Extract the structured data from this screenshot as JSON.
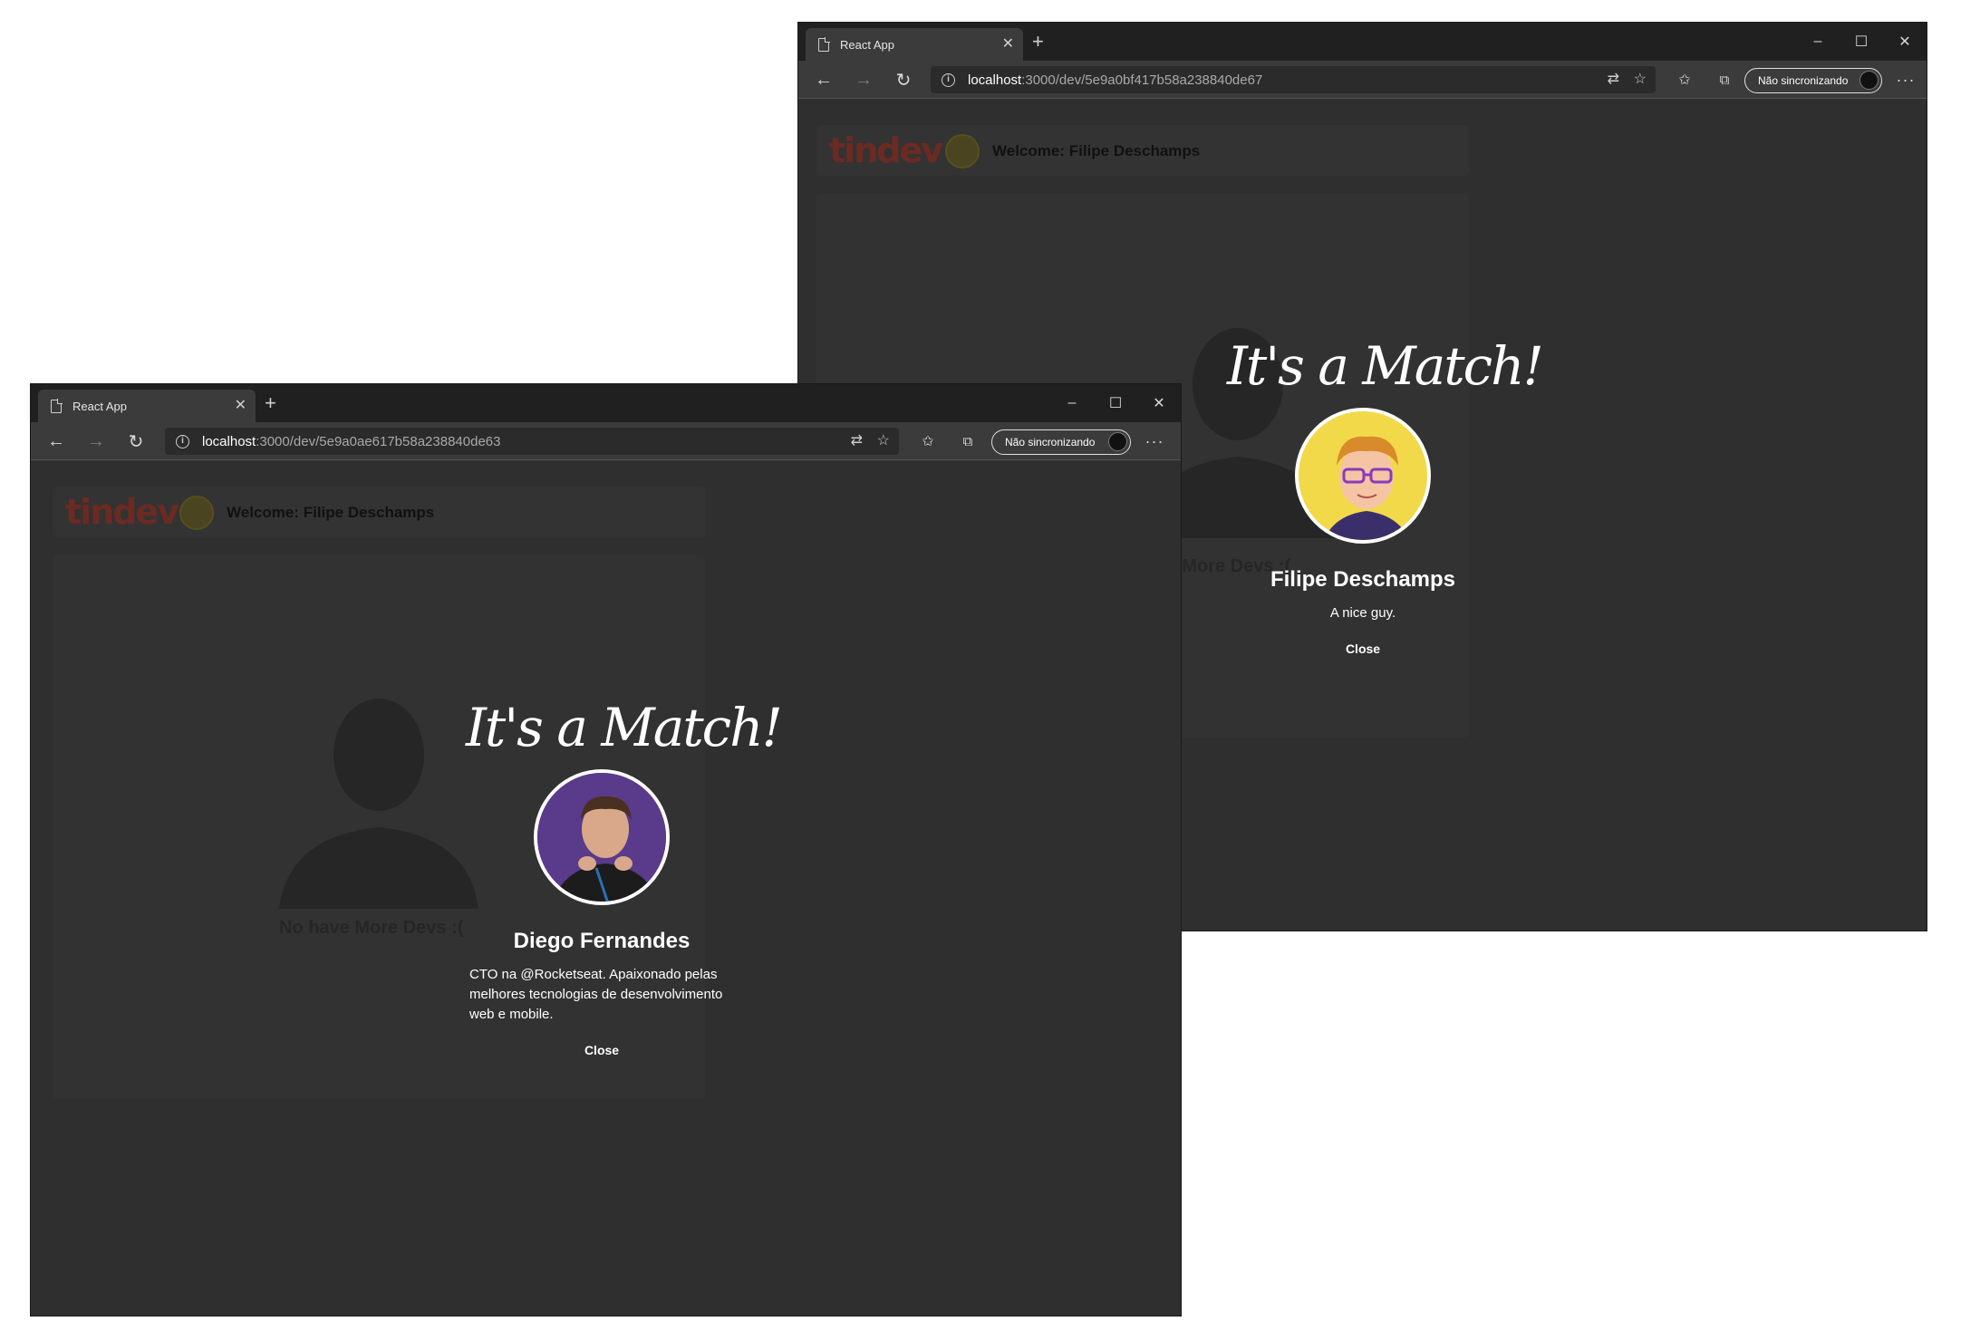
{
  "windows": [
    {
      "id": "back",
      "tab_title": "React App",
      "url_host": "localhost",
      "url_rest": ":3000/dev/5e9a0bf417b58a238840de67",
      "sync_label": "Não sincronizando",
      "app": {
        "logo": "tindev",
        "welcome": "Welcome: Filipe Deschamps",
        "empty_text": "No have More Devs :("
      },
      "match": {
        "title": "It's a Match!",
        "name": "Filipe Deschamps",
        "bio": "A nice guy.",
        "close_label": "Close",
        "avatar_bg": "#f2d94a"
      }
    },
    {
      "id": "front",
      "tab_title": "React App",
      "url_host": "localhost",
      "url_rest": ":3000/dev/5e9a0ae617b58a238840de63",
      "sync_label": "Não sincronizando",
      "app": {
        "logo": "tindev",
        "welcome": "Welcome: Filipe Deschamps",
        "empty_text": "No have More Devs :("
      },
      "match": {
        "title": "It's a Match!",
        "name": "Diego Fernandes",
        "bio": "CTO na @Rocketseat. Apaixonado pelas melhores tecnologias de desenvolvimento web e mobile.",
        "close_label": "Close",
        "avatar_bg": "#5a3a8a"
      }
    }
  ],
  "icons": {
    "tab": "page-icon",
    "close": "close-icon",
    "new_tab": "plus-icon",
    "back": "arrow-left-icon",
    "forward": "arrow-right-icon",
    "refresh": "refresh-icon",
    "info": "info-icon",
    "translate": "translate-icon",
    "favorite": "star-icon",
    "favorites": "favorites-list-icon",
    "collections": "collections-icon",
    "more": "more-icon"
  }
}
